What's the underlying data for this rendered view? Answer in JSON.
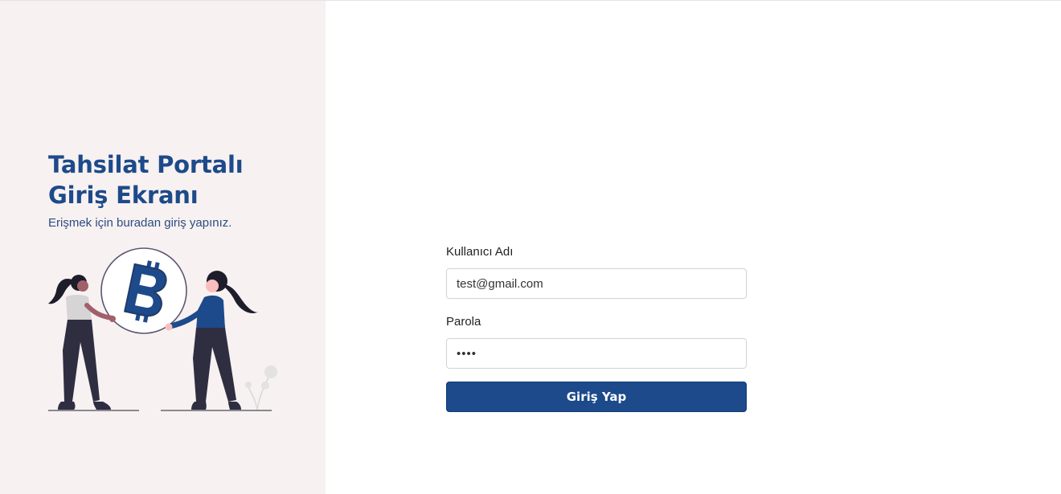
{
  "left_panel": {
    "title_line1": "Tahsilat Portalı",
    "title_line2": "Giriş Ekranı",
    "subtitle": "Erişmek için buradan giriş yapınız.",
    "illustration": {
      "icon": "bitcoin-icon",
      "background_color": "#f7f1f1"
    }
  },
  "login_form": {
    "username_label": "Kullanıcı Adı",
    "username_value": "test@gmail.com",
    "password_label": "Parola",
    "password_value": "1234",
    "submit_label": "Giriş Yap"
  },
  "colors": {
    "accent": "#1c4a8b",
    "title": "#1d4a8a"
  }
}
